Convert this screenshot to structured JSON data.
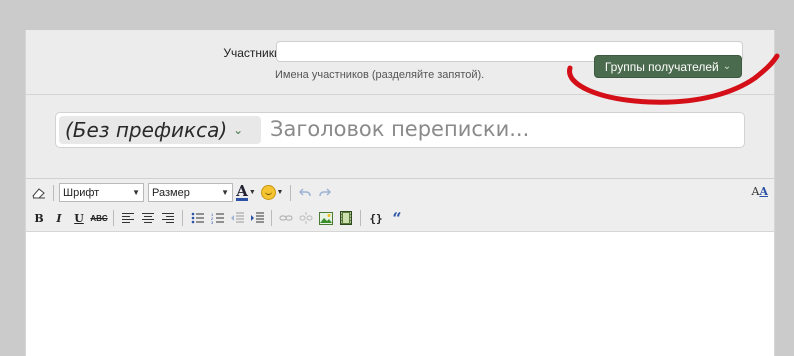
{
  "recipients": {
    "label": "Участники:",
    "value": "",
    "placeholder": "",
    "hint": "Имена участников (разделяйте запятой).",
    "groups_button": "Группы получателей"
  },
  "title_row": {
    "prefix_label": "(Без префикса)",
    "title_placeholder": "Заголовок переписки..."
  },
  "toolbar": {
    "font_select": "Шрифт",
    "size_select": "Размер",
    "font_color_glyph": "A",
    "bold_glyph": "B",
    "italic_glyph": "I",
    "underline_glyph": "U",
    "strike_glyph": "ABC",
    "code_glyph": "{}",
    "quote_glyph": "“",
    "remove_format_glyph": "A"
  },
  "annotation": {
    "color": "#d40f18"
  },
  "colors": {
    "groups_button_bg": "#4b6b4e",
    "page_bg": "#cbcbcb",
    "panel_bg": "#ececec"
  }
}
